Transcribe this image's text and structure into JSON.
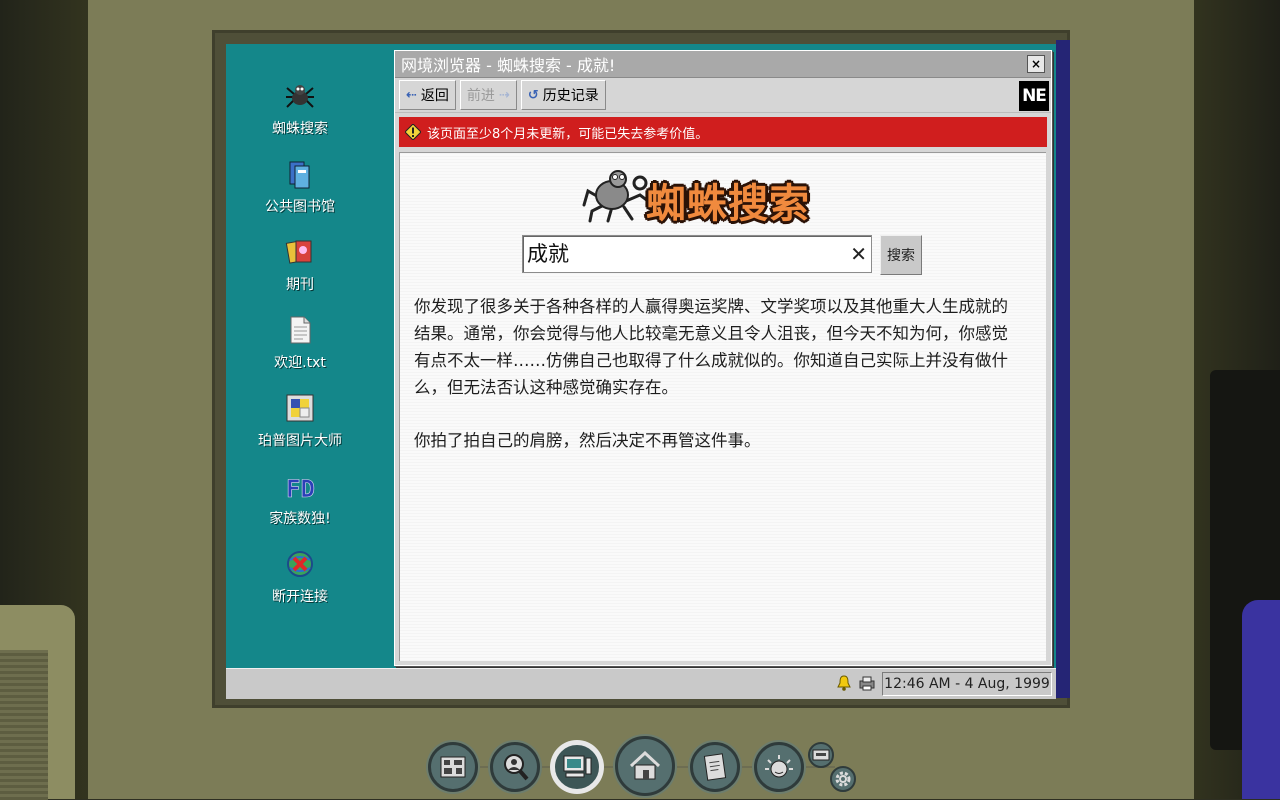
{
  "desktop": {
    "icons": [
      {
        "label": "蜘蛛搜索",
        "icon": "spider-icon"
      },
      {
        "label": "公共图书馆",
        "icon": "books-icon"
      },
      {
        "label": "期刊",
        "icon": "magazines-icon"
      },
      {
        "label": "欢迎.txt",
        "icon": "text-file-icon"
      },
      {
        "label": "珀普图片大师",
        "icon": "picture-app-icon"
      },
      {
        "label": "家族数独!",
        "icon": "fd-sudoku-icon"
      },
      {
        "label": "断开连接",
        "icon": "disconnect-icon"
      }
    ]
  },
  "browser": {
    "title": "网境浏览器 - 蜘蛛搜索 - 成就!",
    "close_label": "×",
    "toolbar": {
      "back_label": "返回",
      "forward_label": "前进",
      "history_label": "历史记录",
      "brand": "NE"
    },
    "warning": "该页面至少8个月未更新，可能已失去参考价值。",
    "page": {
      "logo_text": "蜘蛛搜索",
      "search_value": "成就",
      "search_button": "搜索",
      "paragraphs": [
        "你发现了很多关于各种各样的人赢得奥运奖牌、文学奖项以及其他重大人生成就的结果。通常，你会觉得与他人比较毫无意义且令人沮丧，但今天不知为何，你感觉有点不太一样……仿佛自己也取得了什么成就似的。你知道自己实际上并没有做什么，但无法否认这种感觉确实存在。",
        "你拍了拍自己的肩膀，然后决定不再管这件事。"
      ]
    }
  },
  "taskbar": {
    "clock": "12:46 AM - 4 Aug, 1999",
    "tray": [
      "bell-icon",
      "printer-icon"
    ]
  },
  "dock": {
    "buttons": [
      "circuit-board-icon",
      "search-person-icon",
      "computer-icon",
      "home-icon",
      "notebook-icon",
      "sun-face-icon",
      "tape-icon",
      "gear-icon"
    ],
    "active": "computer-icon"
  }
}
